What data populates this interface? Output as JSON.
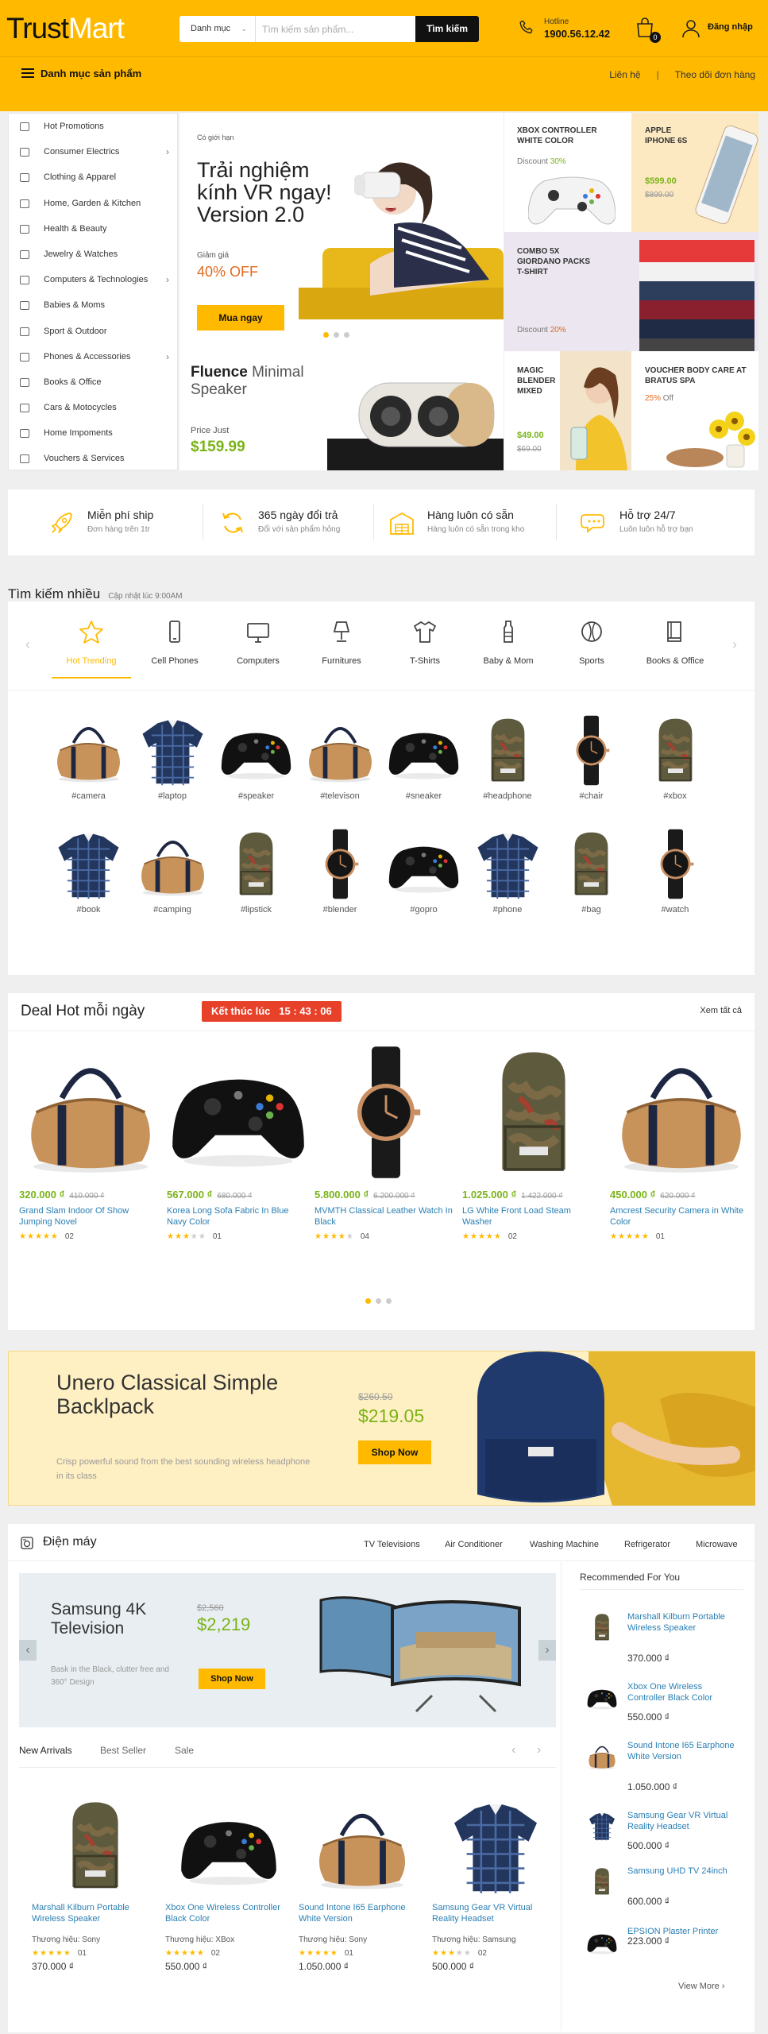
{
  "header": {
    "logo_part1": "Trust",
    "logo_part2": "Mart",
    "search_category": "Danh mục",
    "search_placeholder": "Tìm kiếm sản phẩm...",
    "search_button": "Tìm kiếm",
    "hotline_label": "Hotline",
    "hotline_number": "1900.56.12.42",
    "cart_count": "0",
    "login_label": "Đăng nhập",
    "menu_label": "Danh mục sản phẩm",
    "links": [
      "Liên hệ",
      "Theo dõi đơn hàng"
    ]
  },
  "sidebar": {
    "items": [
      {
        "label": "Hot Promotions",
        "icon": "star-icon",
        "arrow": false
      },
      {
        "label": "Consumer Electrics",
        "icon": "radio-icon",
        "arrow": true
      },
      {
        "label": "Clothing & Apparel",
        "icon": "shirt-icon",
        "arrow": false
      },
      {
        "label": "Home, Garden & Kitchen",
        "icon": "lamp-icon",
        "arrow": false
      },
      {
        "label": "Health & Beauty",
        "icon": "heartbeat-icon",
        "arrow": false
      },
      {
        "label": "Jewelry & Watches",
        "icon": "diamond-icon",
        "arrow": false
      },
      {
        "label": "Computers & Technologies",
        "icon": "monitor-icon",
        "arrow": true
      },
      {
        "label": "Babies & Moms",
        "icon": "bottle-icon",
        "arrow": false
      },
      {
        "label": "Sport & Outdoor",
        "icon": "ball-icon",
        "arrow": false
      },
      {
        "label": "Phones & Accessories",
        "icon": "phone-icon",
        "arrow": true
      },
      {
        "label": "Books & Office",
        "icon": "book-icon",
        "arrow": false
      },
      {
        "label": "Cars & Motocycles",
        "icon": "car-icon",
        "arrow": false
      },
      {
        "label": "Home Impoments",
        "icon": "tools-icon",
        "arrow": false
      },
      {
        "label": "Vouchers & Services",
        "icon": "ticket-icon",
        "arrow": false
      }
    ]
  },
  "hero": {
    "tag": "Có giới hạn",
    "title": "Trải nghiệm kính VR ngay! Version 2.0",
    "sale_label": "Giảm giá",
    "sale_value": "40% OFF",
    "button": "Mua ngay"
  },
  "tiles": {
    "xbox": {
      "title": "XBOX CONTROLLER WHITE COLOR",
      "label": "Discount",
      "value": "30%"
    },
    "iphone": {
      "title": "APPLE IPHONE 6S",
      "price": "$599.00",
      "old": "$899.00"
    },
    "combo": {
      "title": "COMBO 5X GIORDANO PACKS T-SHIRT",
      "label": "Discount",
      "value": "20%"
    },
    "speaker": {
      "title_bold": "Fluence",
      "title_rest": " Minimal Speaker",
      "label": "Price Just",
      "price": "$159.99"
    },
    "blender": {
      "title": "MAGIC BLENDER MIXED",
      "price": "$49.00",
      "old": "$69.00"
    },
    "voucher": {
      "title": "VOUCHER BODY CARE AT BRATUS SPA",
      "value": "25%",
      "suffix": "Off"
    }
  },
  "features": [
    {
      "title": "Miễn phí ship",
      "sub": "Đơn hàng trên 1tr",
      "icon": "rocket-icon"
    },
    {
      "title": "365 ngày đổi trả",
      "sub": "Đổi với sản phẩm hỏng",
      "icon": "refresh-icon"
    },
    {
      "title": "Hàng luôn có sẵn",
      "sub": "Hàng luôn có sẵn trong kho",
      "icon": "warehouse-icon"
    },
    {
      "title": "Hỗ trợ 24/7",
      "sub": "Luôn luôn hỗ trợ bạn",
      "icon": "chat-icon"
    }
  ],
  "popular": {
    "title": "Tìm kiếm nhiều",
    "updated": "Cập nhật lúc 9:00AM",
    "tabs": [
      {
        "label": "Hot Trending",
        "icon": "star-icon"
      },
      {
        "label": "Cell Phones",
        "icon": "phone-icon"
      },
      {
        "label": "Computers",
        "icon": "monitor-icon"
      },
      {
        "label": "Furnitures",
        "icon": "lamp-icon"
      },
      {
        "label": "T-Shirts",
        "icon": "shirt-icon"
      },
      {
        "label": "Baby & Mom",
        "icon": "bottle-icon"
      },
      {
        "label": "Sports",
        "icon": "ball-icon"
      },
      {
        "label": "Books & Office",
        "icon": "book-icon"
      }
    ],
    "tags_row1": [
      "#camera",
      "#laptop",
      "#speaker",
      "#televison",
      "#sneaker",
      "#headphone",
      "#chair",
      "#xbox"
    ],
    "tags_row2": [
      "#book",
      "#camping",
      "#lipstick",
      "#blender",
      "#gopro",
      "#phone",
      "#bag",
      "#watch"
    ]
  },
  "deal": {
    "title": "Deal Hot mỗi ngày",
    "timer_label": "Kết thúc lúc",
    "timer_value": "15 : 43 : 06",
    "view_all": "Xem tất cả",
    "items": [
      {
        "price": "320.000 ₫",
        "old": "410.000 ₫",
        "name": "Grand Slam Indoor Of Show Jumping Novel",
        "rating": 5,
        "count": "02"
      },
      {
        "price": "567.000 ₫",
        "old": "680.000 ₫",
        "name": "Korea Long Sofa Fabric In Blue Navy Color",
        "rating": 3,
        "count": "01"
      },
      {
        "price": "5.800.000 ₫",
        "old": "6.200.000 ₫",
        "name": "MVMTH Classical Leather Watch In Black",
        "rating": 4,
        "count": "04"
      },
      {
        "price": "1.025.000 ₫",
        "old": "1.422.000 ₫",
        "name": "LG White Front Load Steam Washer",
        "rating": 5,
        "count": "02"
      },
      {
        "price": "450.000 ₫",
        "old": "620.000 ₫",
        "name": "Amcrest Security Camera in White Color",
        "rating": 5,
        "count": "01"
      }
    ]
  },
  "banner": {
    "title": "Unero Classical Simple Backlpack",
    "desc": "Crisp powerful sound from the best sounding wireless headphone in its class",
    "old_price": "$260.50",
    "price": "$219.05",
    "button": "Shop Now"
  },
  "electronics": {
    "title": "Điện máy",
    "tabs": [
      "TV Televisions",
      "Air Conditioner",
      "Washing Machine",
      "Refrigerator",
      "Microwave"
    ],
    "promo": {
      "title": "Samsung 4K Television",
      "old": "$2,560",
      "price": "$2,219",
      "desc": "Bask in the Black, clutter free and 360° Design",
      "button": "Shop Now"
    },
    "subtabs": [
      "New Arrivals",
      "Best Seller",
      "Sale"
    ],
    "brand_label": "Thương hiệu:",
    "items": [
      {
        "name": "Marshall Kilburn Portable Wireless Speaker",
        "brand": "Sony",
        "rating": 5,
        "count": "01",
        "price": "370.000 ₫"
      },
      {
        "name": "Xbox One Wireless Controller Black Color",
        "brand": "XBox",
        "rating": 5,
        "count": "02",
        "price": "550.000 ₫"
      },
      {
        "name": "Sound Intone I65 Earphone White Version",
        "brand": "Sony",
        "rating": 5,
        "count": "01",
        "price": "1.050.000 ₫"
      },
      {
        "name": "Samsung Gear VR Virtual Reality Headset",
        "brand": "Samsung",
        "rating": 3,
        "count": "02",
        "price": "500.000 ₫"
      }
    ],
    "recommended_title": "Recommended For You",
    "recommended": [
      {
        "name": "Marshall Kilburn Portable Wireless Speaker",
        "price": "370.000 ₫"
      },
      {
        "name": "Xbox One Wireless Controller Black Color",
        "price": "550.000 ₫"
      },
      {
        "name": "Sound Intone I65 Earphone White Version",
        "price": "1.050.000 ₫"
      },
      {
        "name": "Samsung Gear VR Virtual Reality Headset",
        "price": "500.000 ₫"
      },
      {
        "name": "Samsung UHD TV 24inch",
        "price": "600.000 ₫"
      },
      {
        "name": "EPSION Plaster Printer",
        "price": "223.000 ₫"
      }
    ],
    "view_more": "View More"
  },
  "colors": {
    "brand": "#ffba00",
    "price_green": "#7ab317",
    "discount_orange": "#e06a1f",
    "link_blue": "#2a7fb3",
    "timer_red": "#e8412a"
  }
}
